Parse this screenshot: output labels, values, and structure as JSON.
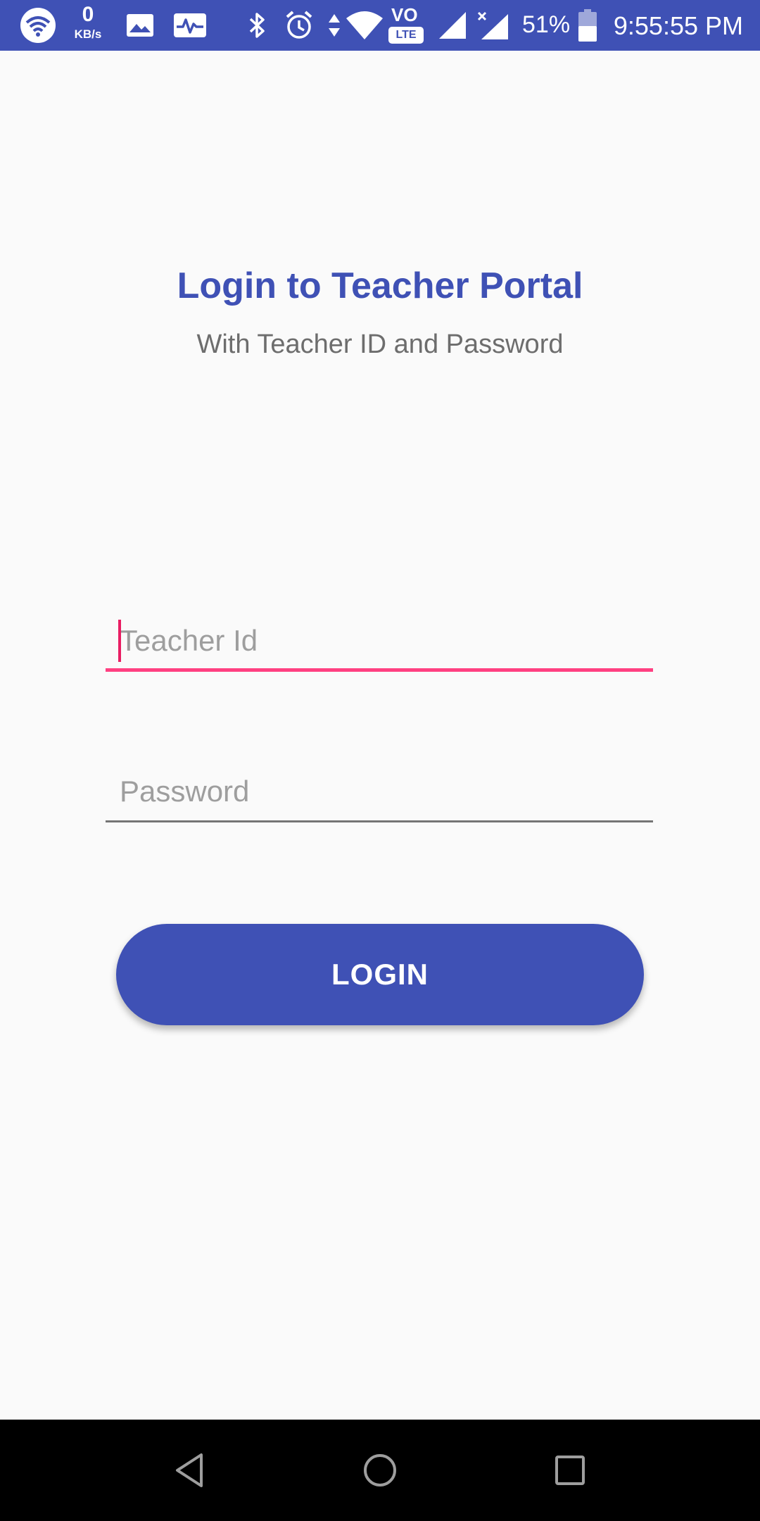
{
  "status_bar": {
    "network_speed_value": "0",
    "network_speed_unit": "KB/s",
    "volte_label": "VO",
    "lte_label": "LTE",
    "battery_percent": "51%",
    "time": "9:55:55 PM",
    "icons": [
      "wifi-icon",
      "gallery-icon",
      "activity-icon",
      "bluetooth-icon",
      "alarm-icon",
      "data-arrows-icon",
      "wifi-signal-icon",
      "volte-icon",
      "cell-signal-icon",
      "cell-signal-no-sim-icon",
      "battery-icon"
    ]
  },
  "login": {
    "title": "Login to Teacher Portal",
    "subtitle": "With Teacher ID and Password",
    "teacher_id": {
      "placeholder": "Teacher Id",
      "value": ""
    },
    "password": {
      "placeholder": "Password",
      "value": ""
    },
    "login_button_label": "LOGIN"
  },
  "colors": {
    "primary": "#3f51b5",
    "accent": "#ff4081",
    "background": "#fafafa"
  },
  "nav_bar": {
    "icons": [
      "back-icon",
      "home-icon",
      "recents-icon"
    ]
  }
}
